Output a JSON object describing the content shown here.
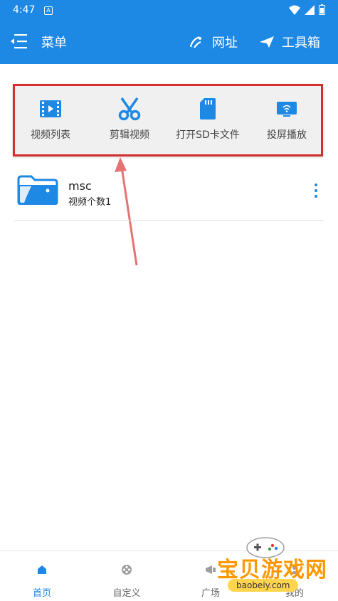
{
  "status_bar": {
    "time": "4:47",
    "badge": "A"
  },
  "app_bar": {
    "menu_label": "菜单",
    "url_label": "网址",
    "tools_label": "工具箱",
    "accent": "#1e88e5"
  },
  "quick_actions": [
    {
      "label": "视频列表",
      "icon": "video-list-icon"
    },
    {
      "label": "剪辑视频",
      "icon": "scissors-icon"
    },
    {
      "label": "打开SD卡文件",
      "icon": "sd-card-icon"
    },
    {
      "label": "投屏播放",
      "icon": "cast-screen-icon"
    }
  ],
  "folders": [
    {
      "name": "msc",
      "subtitle": "视频个数1"
    }
  ],
  "bottom_nav": [
    {
      "label": "首页",
      "icon": "home-icon",
      "active": true
    },
    {
      "label": "自定义",
      "icon": "reel-icon",
      "active": false
    },
    {
      "label": "广场",
      "icon": "square-icon",
      "active": false
    },
    {
      "label": "我的",
      "icon": "profile-icon",
      "active": false
    }
  ],
  "watermark": {
    "text": "宝贝游戏网",
    "url": "baobeiy.com"
  }
}
